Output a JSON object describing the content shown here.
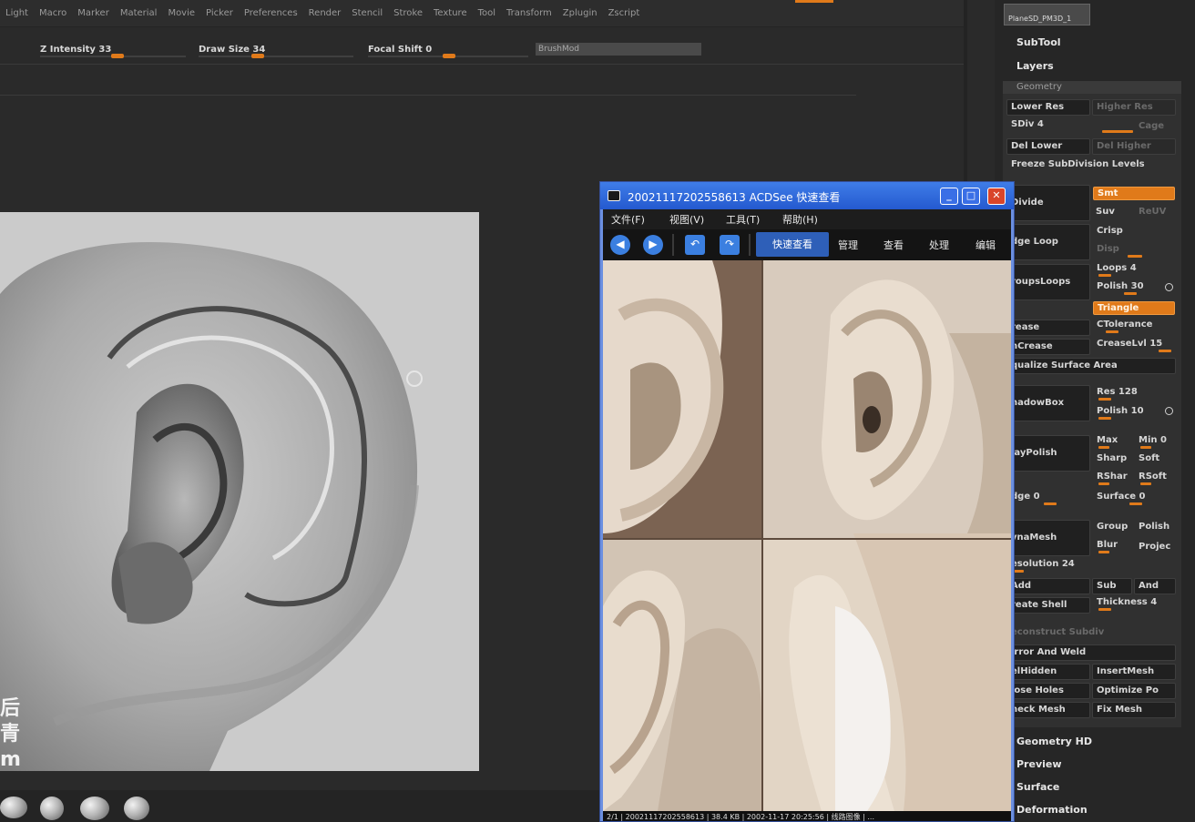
{
  "menubar": {
    "items": [
      "Light",
      "Macro",
      "Marker",
      "Material",
      "Movie",
      "Picker",
      "Preferences",
      "Render",
      "Stencil",
      "Stroke",
      "Texture",
      "Tool",
      "Transform",
      "Zplugin",
      "Zscript"
    ]
  },
  "brush_settings": {
    "z_intensity": {
      "label": "Z Intensity 33",
      "value": 33
    },
    "draw_size": {
      "label": "Draw Size 34",
      "value": 34
    },
    "focal_shift": {
      "label": "Focal Shift 0",
      "value": 0
    },
    "brush_field": "BrushMod"
  },
  "tool_palette": {
    "tool_thumbnail": "PlaneSD_PM3D_1",
    "sections": {
      "subtool": "SubTool",
      "layers": "Layers",
      "geometry": "Geometry",
      "geometry_hd": "Geometry HD",
      "preview": "Preview",
      "surface": "Surface",
      "deformation": "Deformation"
    },
    "geometry": {
      "lower_res": "Lower Res",
      "higher_res": "Higher Res",
      "sdiv": "SDiv 4",
      "cage": "Cage",
      "del_lower": "Del Lower",
      "del_higher": "Del Higher",
      "freeze": "Freeze SubDivision Levels",
      "divide": "Divide",
      "smt": "Smt",
      "suv": "Suv",
      "reuv": "ReUV",
      "edge_loop": "dge Loop",
      "crisp": "Crisp",
      "disp": "Disp",
      "groups_loops": "roupsLoops",
      "loops": "Loops 4",
      "polish": "Polish 30",
      "triangle": "Triangle",
      "crease": "rease",
      "ctolerance": "CTolerance",
      "uncrease": "nCrease",
      "creaselvl": "CreaseLvl 15",
      "equalize": "qualize Surface Area",
      "shadowbox": "hadowBox",
      "res": "Res 128",
      "polish2": "Polish 10",
      "claypolish": "layPolish",
      "max": "Max",
      "min": "Min 0",
      "sharp": "Sharp",
      "soft": "Soft",
      "rshar": "RShar",
      "rsoft": "RSoft",
      "edge": "dge 0",
      "surface": "Surface 0",
      "dynamesh": "ynaMesh",
      "group": "Group",
      "polish3": "Polish",
      "blur": "Blur",
      "project": "Projec",
      "resolution": "esolution 24",
      "add": "Add",
      "sub": "Sub",
      "and": "And",
      "create_shell": "reate Shell",
      "thickness": "Thickness 4",
      "reconstruct": "econstruct Subdiv",
      "mirror_weld": "irror And Weld",
      "delhidden": "elHidden",
      "insertmesh": "InsertMesh",
      "close_holes": "lose Holes",
      "optimize": "Optimize Po",
      "check_mesh": "heck Mesh",
      "fix_mesh": "Fix Mesh"
    }
  },
  "acdsee": {
    "title": "20021117202558613    ACDSee 快速查看",
    "window_buttons": {
      "minimize": "_",
      "maximize": "□",
      "close": "✕"
    },
    "menu": [
      "文件(F)",
      "视图(V)",
      "工具(T)",
      "帮助(H)"
    ],
    "toolbar": {
      "prev": "◀",
      "next": "▶",
      "rotate_left": "↶",
      "rotate_right": "↷",
      "tabs": [
        "快速查看",
        "管理",
        "查看",
        "处理",
        "编辑"
      ]
    },
    "status": "2/1 | 20021117202558613 | 38.4 KB | 2002-11-17 20:25:56 | 线路图像 | ..."
  },
  "viewport": {
    "watermark_chars": [
      "后",
      "青",
      "m"
    ]
  },
  "colors": {
    "accent": "#e07a1a",
    "panel_bg": "#262626",
    "acdsee_blue": "#2f5fd8"
  }
}
